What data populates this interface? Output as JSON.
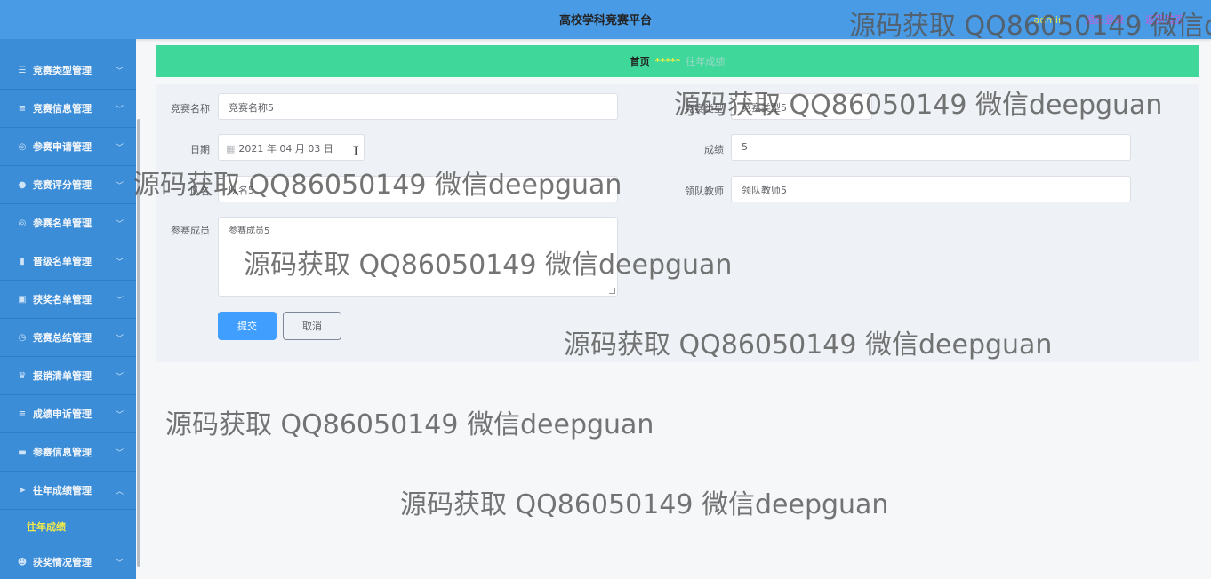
{
  "header": {
    "title": "高校学科竞赛平台",
    "user": "admin",
    "exit": "退出登录",
    "back": "返回首页"
  },
  "sidebar": {
    "items": [
      {
        "icon": "sliders-icon",
        "glyph": "☰",
        "label": "竞赛类型管理"
      },
      {
        "icon": "list-icon",
        "glyph": "≡",
        "label": "竞赛信息管理"
      },
      {
        "icon": "globe-icon",
        "glyph": "◎",
        "label": "参赛申请管理"
      },
      {
        "icon": "pin-icon",
        "glyph": "●",
        "label": "竞赛评分管理"
      },
      {
        "icon": "globe-icon",
        "glyph": "◎",
        "label": "参赛名单管理"
      },
      {
        "icon": "bar-chart-icon",
        "glyph": "▮",
        "label": "晋级名单管理"
      },
      {
        "icon": "clipboard-icon",
        "glyph": "▣",
        "label": "获奖名单管理"
      },
      {
        "icon": "clock-icon",
        "glyph": "◷",
        "label": "竞赛总结管理"
      },
      {
        "icon": "trophy-icon",
        "glyph": "♛",
        "label": "报销清单管理"
      },
      {
        "icon": "list-icon",
        "glyph": "≡",
        "label": "成绩申诉管理"
      },
      {
        "icon": "monitor-icon",
        "glyph": "▬",
        "label": "参赛信息管理"
      },
      {
        "icon": "send-icon",
        "glyph": "➤",
        "label": "往年成绩管理"
      },
      {
        "icon": "user-icon",
        "glyph": "☻",
        "label": "获奖情况管理"
      }
    ],
    "submenu_label": "往年成绩"
  },
  "breadcrumb": {
    "home": "首页",
    "separator": "*****",
    "current": "往年成绩"
  },
  "form": {
    "name_label": "竞赛名称",
    "name_value": "竞赛名称5",
    "type_label": "竞赛类型",
    "type_value": "竞赛类型5",
    "date_label": "日期",
    "date_value": "2021 年 04 月 03 日",
    "score_label": "成绩",
    "score_value": "5",
    "team_label": "队名",
    "team_value": "队名5",
    "teacher_label": "领队教师",
    "teacher_value": "领队教师5",
    "members_label": "参赛成员",
    "members_value": "参赛成员5",
    "submit_label": "提交",
    "cancel_label": "取消"
  },
  "watermark": "源码获取 QQ86050149 微信deepguan",
  "watermark_cut": "源码获取 QQ86050149 微信d"
}
